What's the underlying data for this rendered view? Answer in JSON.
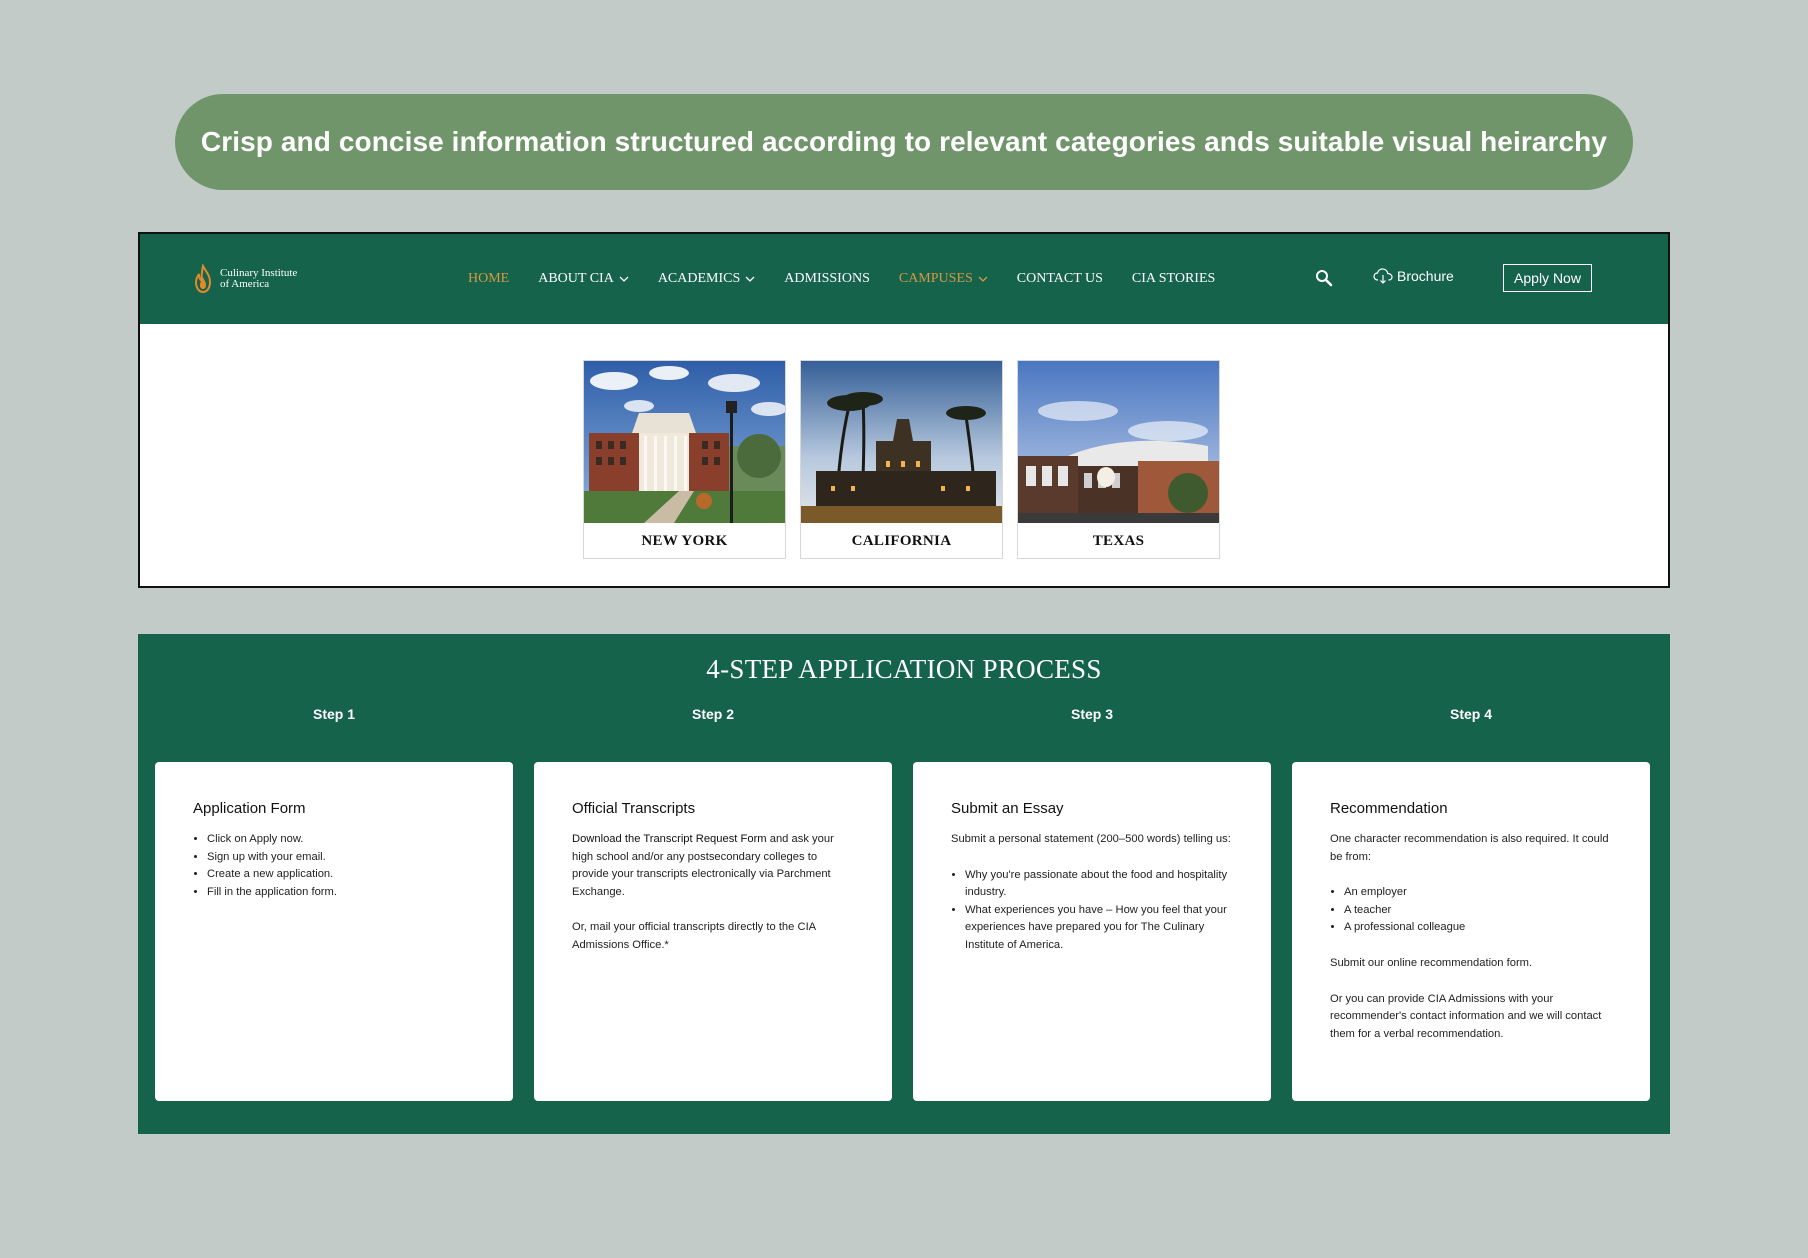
{
  "banner": {
    "text": "Crisp and concise information structured according to relevant categories ands suitable visual heirarchy"
  },
  "colors": {
    "brand_green": "#15634a",
    "accent_gold": "#d49a43",
    "pill_green": "#71956b",
    "background": "#c3cbc8"
  },
  "header": {
    "logo_line1": "Culinary Institute",
    "logo_line2": "of America",
    "menu": [
      {
        "label": "HOME",
        "active": true
      },
      {
        "label": "ABOUT CIA",
        "dropdown": true
      },
      {
        "label": "ACADEMICS",
        "dropdown": true
      },
      {
        "label": "ADMISSIONS"
      },
      {
        "label": "CAMPUSES",
        "dropdown": true,
        "active": true
      },
      {
        "label": "CONTACT US"
      },
      {
        "label": "CIA STORIES"
      }
    ],
    "search_icon": "search-icon",
    "brochure_label": "Brochure",
    "brochure_icon": "cloud-download-icon",
    "apply_label": "Apply Now"
  },
  "campuses": [
    {
      "name": "NEW YORK"
    },
    {
      "name": "CALIFORNIA"
    },
    {
      "name": "TEXAS"
    }
  ],
  "process": {
    "title": "4-STEP APPLICATION PROCESS",
    "steps": [
      {
        "label": "Step 1",
        "title": "Application Form",
        "items": [
          "Click on Apply now.",
          "Sign up with your email.",
          "Create a new application.",
          "Fill in the application form."
        ]
      },
      {
        "label": "Step 2",
        "title": "Official Transcripts",
        "link_text": "Download the Transcript Request Form",
        "p1_rest": " and ask your high school and/or any postsecondary colleges to provide your transcripts electronically via Parchment Exchange.",
        "p2": "Or, mail your official transcripts directly to the CIA Admissions Office.*"
      },
      {
        "label": "Step 3",
        "title": "Submit an Essay",
        "intro": "Submit a personal statement (200–500 words) telling us:",
        "items": [
          "Why you're passionate about the food and hospitality industry.",
          "What experiences you have – How you feel that your experiences have prepared you for The Culinary Institute of America."
        ]
      },
      {
        "label": "Step 4",
        "title": "Recommendation",
        "intro": "One character recommendation is also required. It could be from:",
        "items": [
          "An employer",
          "A teacher",
          "A professional colleague"
        ],
        "p2": "Submit our online recommendation form.",
        "p3": "Or you can provide CIA Admissions with your recommender's contact information and we will contact them for a verbal recommendation."
      }
    ]
  }
}
